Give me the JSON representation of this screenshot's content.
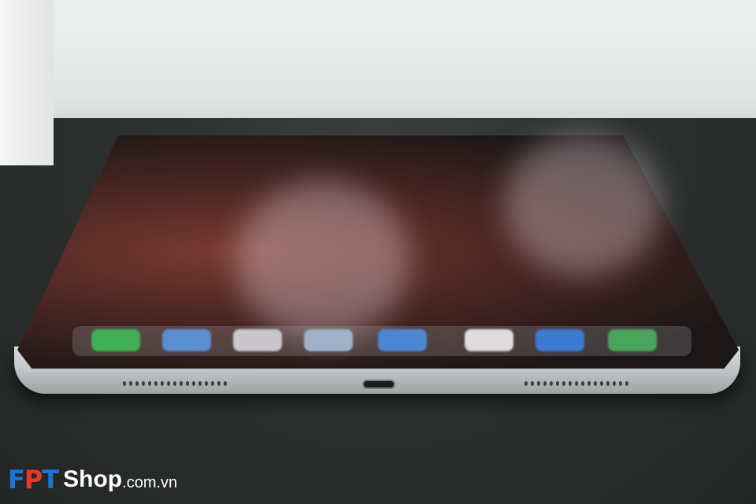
{
  "watermark": {
    "mark_left": "F",
    "mark_middle": "P",
    "mark_right": "T",
    "brand": "Shop",
    "suffix": ".com.vn",
    "colors": {
      "blue": "#1877d6",
      "red": "#e8392b"
    }
  },
  "scene": {
    "subject": "tablet-bottom-edge-with-usb-c-port",
    "dock_icons": [
      "messages-icon",
      "safari-icon",
      "music-icon",
      "mail-icon",
      "files-icon",
      "photos-icon",
      "app-store-icon",
      "facetime-icon"
    ]
  }
}
